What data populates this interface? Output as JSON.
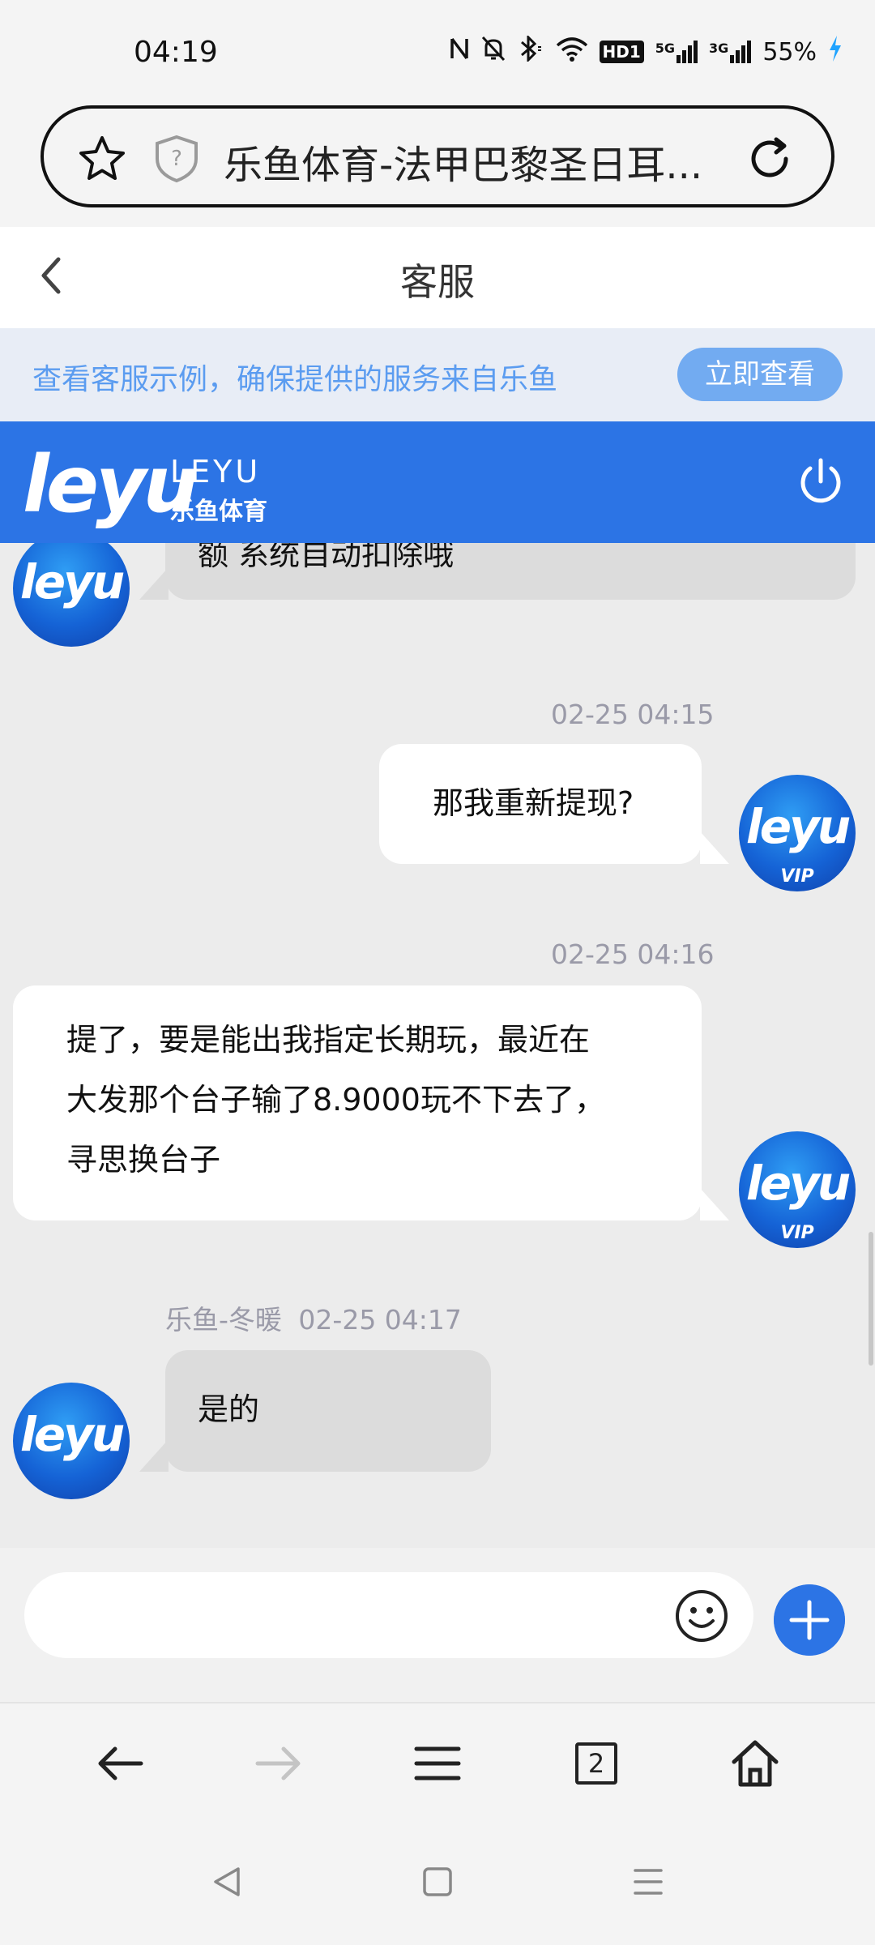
{
  "status_bar": {
    "time": "04:19",
    "icons": [
      "nfc-icon",
      "mute-icon",
      "bluetooth-icon",
      "wifi-icon",
      "hd-icon",
      "signal-5g-icon",
      "signal-3g-icon"
    ],
    "hd_label": "HD1",
    "net1": "5G",
    "net2": "3G",
    "battery": "55%"
  },
  "browser": {
    "page_title": "乐鱼体育-法甲巴黎圣日耳...",
    "tab_count": "2"
  },
  "header": {
    "title": "客服"
  },
  "notice": {
    "text": "查看客服示例，确保提供的服务来自乐鱼",
    "button": "立即查看"
  },
  "brand": {
    "logo": "leyu",
    "logo_en": "LEYU",
    "logo_cn": "乐鱼体育"
  },
  "messages": [
    {
      "side": "agent",
      "text": "额 系统自动扣除哦",
      "partial": true
    },
    {
      "side": "user",
      "time": "02-25 04:15",
      "text": "那我重新提现?"
    },
    {
      "side": "user",
      "time": "02-25 04:16",
      "lines": [
        "提了，要是能出我指定长期玩，最近在",
        "大发那个台子输了8.9000玩不下去了，",
        "寻思换台子"
      ]
    },
    {
      "side": "agent",
      "sender": "乐鱼-冬暖",
      "time": "02-25 04:17",
      "text": "是的"
    }
  ],
  "avatar": {
    "text": "leyu",
    "vip": "VIP"
  },
  "input": {
    "placeholder": ""
  },
  "colors": {
    "brand_blue": "#2c74e5",
    "notice_text": "#5b9cf0",
    "chat_bg": "#ececec",
    "agent_bubble": "#dcdcdc",
    "user_bubble": "#ffffff"
  }
}
